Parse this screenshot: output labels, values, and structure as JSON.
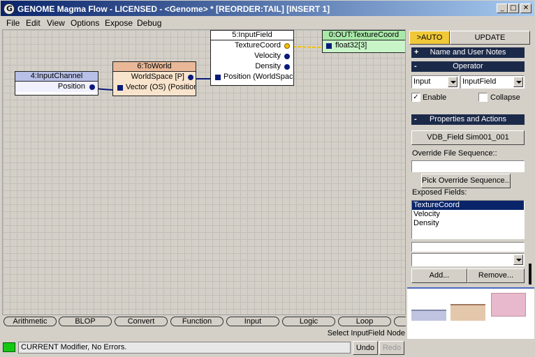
{
  "window": {
    "title": "GENOME Magma Flow - LICENSED - <Genome> *  [REORDER:TAIL] [INSERT 1]",
    "controls": [
      "_",
      "□",
      "✕"
    ]
  },
  "menu": [
    "File",
    "Edit",
    "View",
    "Options",
    "Expose",
    "Debug"
  ],
  "nodes": {
    "input_channel": {
      "title": "4:InputChannel",
      "port": "Position",
      "header_color": "#b8c0e8"
    },
    "to_world": {
      "title": "6:ToWorld",
      "out_port": "WorldSpace [P]",
      "in_port": "Vector (OS) (Position)",
      "header_color": "#e8b898",
      "body_color": "#f8e4cc"
    },
    "input_field": {
      "title": "5:InputField",
      "ports": [
        "TextureCoord",
        "Velocity",
        "Density"
      ],
      "in_port": "Position (WorldSpace)"
    },
    "output": {
      "title": "0:OUT:TextureCoord",
      "port": "float32[3]",
      "color": "#c8f4c8"
    }
  },
  "panel": {
    "auto_button": ">AUTO",
    "update_button": "UPDATE",
    "name_notes": {
      "sign": "+",
      "label": "Name and User Notes"
    },
    "operator": {
      "sign": "-",
      "label": "Operator"
    },
    "op_select_1": "Input",
    "op_select_2": "InputField",
    "enable_label": "Enable",
    "enable_checked": "✓",
    "collapse_label": "Collapse",
    "props": {
      "sign": "-",
      "label": "Properties and Actions"
    },
    "vdb_button": "VDB_Field Sim001_001",
    "override_label": "Override File Sequence::",
    "pick_button": "Pick Override Sequence...",
    "exposed_label": "Exposed Fields:",
    "exposed_fields": [
      "TextureCoord",
      "Velocity",
      "Density"
    ],
    "add_button": "Add...",
    "remove_button": "Remove..."
  },
  "swatches": [
    "#c0c4e0",
    "#e4c8ac",
    "#e8b8cc"
  ],
  "categories": [
    "Arithmetic",
    "BLOP",
    "Convert",
    "Function",
    "Input",
    "Logic",
    "Loop"
  ],
  "hint": "Select InputField Node",
  "status": {
    "text": "CURRENT Modifier, No Errors.",
    "undo": "Undo",
    "redo": "Redo"
  },
  "colors": {
    "wire_yellow": "#f4c000",
    "wire_blue": "#0a1a7a",
    "auto_button": "#f0c838"
  }
}
